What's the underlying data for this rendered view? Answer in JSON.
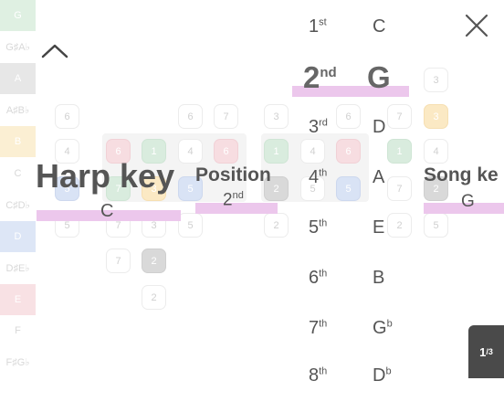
{
  "key_strip": [
    {
      "label": "G",
      "color": "green"
    },
    {
      "label": "G♯A♭",
      "color": "none"
    },
    {
      "label": "A",
      "color": "gray"
    },
    {
      "label": "A♯B♭",
      "color": "none"
    },
    {
      "label": "B",
      "color": "yellow"
    },
    {
      "label": "C",
      "color": "none"
    },
    {
      "label": "C♯D♭",
      "color": "none"
    },
    {
      "label": "D",
      "color": "blue"
    },
    {
      "label": "D♯E♭",
      "color": "none"
    },
    {
      "label": "E",
      "color": "pink"
    },
    {
      "label": "F",
      "color": "none"
    },
    {
      "label": "F♯G♭",
      "color": "none"
    }
  ],
  "grid_cells": [
    {
      "t": "6",
      "c": "none"
    },
    {
      "t": "6",
      "c": "none"
    },
    {
      "t": "7",
      "c": "none"
    },
    {
      "t": "3",
      "c": "none"
    },
    {
      "t": "6",
      "c": "none"
    },
    {
      "t": "7",
      "c": "none"
    },
    {
      "t": "3",
      "c": "yellow"
    },
    {
      "t": "3",
      "c": "none"
    },
    {
      "t": "4",
      "c": "none"
    },
    {
      "t": "6",
      "c": "pink"
    },
    {
      "t": "1",
      "c": "green"
    },
    {
      "t": "4",
      "c": "none"
    },
    {
      "t": "6",
      "c": "pink"
    },
    {
      "t": "1",
      "c": "green"
    },
    {
      "t": "4",
      "c": "none"
    },
    {
      "t": "6",
      "c": "pink"
    },
    {
      "t": "1",
      "c": "green"
    },
    {
      "t": "4",
      "c": "none"
    },
    {
      "t": "5",
      "c": "blue"
    },
    {
      "t": "7",
      "c": "green"
    },
    {
      "t": "3",
      "c": "yellow"
    },
    {
      "t": "5",
      "c": "blue"
    },
    {
      "t": "2",
      "c": "gray"
    },
    {
      "t": "5",
      "c": "none"
    },
    {
      "t": "5",
      "c": "blue"
    },
    {
      "t": "7",
      "c": "none"
    },
    {
      "t": "2",
      "c": "gray"
    },
    {
      "t": "5",
      "c": "none"
    },
    {
      "t": "5",
      "c": "none"
    },
    {
      "t": "7",
      "c": "none"
    },
    {
      "t": "3",
      "c": "none"
    },
    {
      "t": "5",
      "c": "none"
    },
    {
      "t": "2",
      "c": "none"
    },
    {
      "t": "2",
      "c": "none"
    },
    {
      "t": "5",
      "c": "none"
    },
    {
      "t": "7",
      "c": "none"
    },
    {
      "t": "2",
      "c": "gray"
    },
    {
      "t": "2",
      "c": "none"
    }
  ],
  "harp_key": {
    "title": "Harp key",
    "value": "C"
  },
  "position": {
    "title": "Position",
    "value": "2",
    "suffix": "nd"
  },
  "song_key": {
    "title": "Song ke",
    "value": "G"
  },
  "picker": [
    {
      "ord": "1",
      "suffix": "st",
      "note": "C",
      "note_sup": "",
      "selected": false
    },
    {
      "ord": "2",
      "suffix": "nd",
      "note": "G",
      "note_sup": "",
      "selected": true
    },
    {
      "ord": "3",
      "suffix": "rd",
      "note": "D",
      "note_sup": "",
      "selected": false
    },
    {
      "ord": "4",
      "suffix": "th",
      "note": "A",
      "note_sup": "",
      "selected": false
    },
    {
      "ord": "5",
      "suffix": "th",
      "note": "E",
      "note_sup": "",
      "selected": false
    },
    {
      "ord": "6",
      "suffix": "th",
      "note": "B",
      "note_sup": "",
      "selected": false
    },
    {
      "ord": "7",
      "suffix": "th",
      "note": "G",
      "note_sup": "b",
      "selected": false
    },
    {
      "ord": "8",
      "suffix": "th",
      "note": "D",
      "note_sup": "b",
      "selected": false
    }
  ],
  "page_indicator": {
    "current": "1",
    "total": "3"
  }
}
